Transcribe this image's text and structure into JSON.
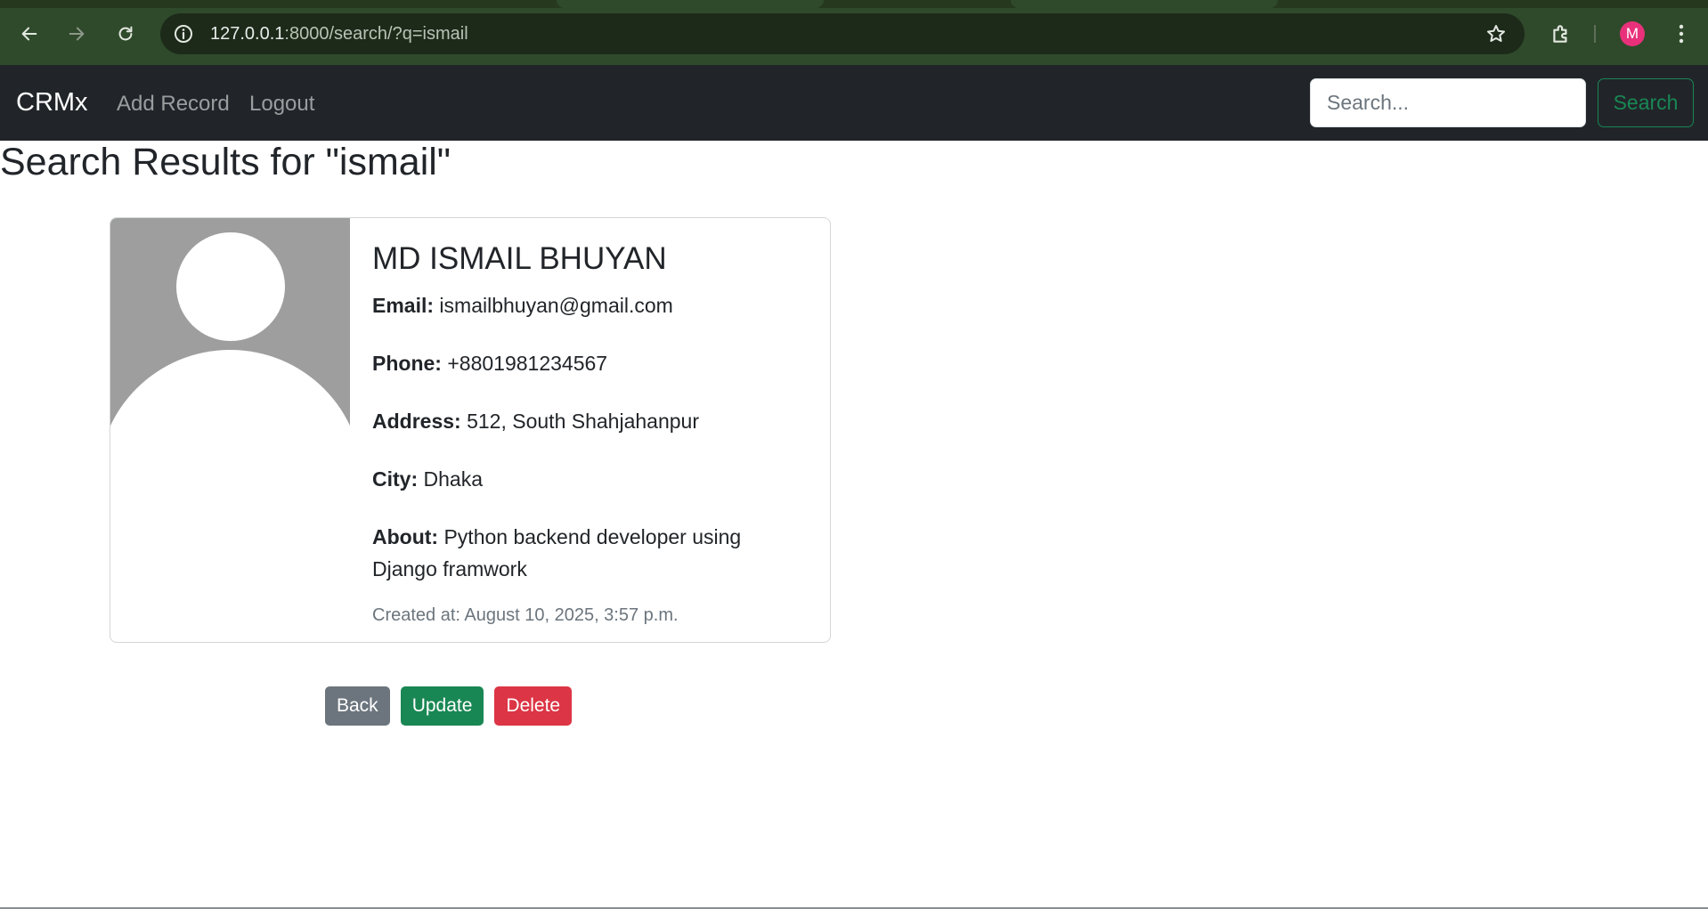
{
  "browser": {
    "url_host": "127.0.0.1",
    "url_rest": ":8000/search/?q=ismail",
    "profile_initial": "M",
    "colors": {
      "frame": "#2f4a2b",
      "omnibox": "#1d2a1a",
      "avatar": "#e8317a"
    },
    "icons": [
      "back-arrow-icon",
      "forward-arrow-icon",
      "reload-icon",
      "site-info-icon",
      "bookmark-star-icon",
      "extensions-puzzle-icon",
      "kebab-menu-icon"
    ]
  },
  "navbar": {
    "brand": "CRMx",
    "links": [
      "Add Record",
      "Logout"
    ],
    "search_placeholder": "Search...",
    "search_button": "Search"
  },
  "page": {
    "title": "Search Results for \"ismail\""
  },
  "record": {
    "name": "MD ISMAIL BHUYAN",
    "email_label": "Email:",
    "email": "ismailbhuyan@gmail.com",
    "phone_label": "Phone:",
    "phone": "+8801981234567",
    "address_label": "Address:",
    "address": "512, South Shahjahanpur",
    "city_label": "City:",
    "city": "Dhaka",
    "about_label": "About:",
    "about": "Python backend developer using Django framwork",
    "created": "Created at: August 10, 2025, 3:57 p.m."
  },
  "actions": {
    "back": "Back",
    "update": "Update",
    "delete": "Delete"
  },
  "colors": {
    "navbar_bg": "#212529",
    "success": "#198754",
    "danger": "#dc3545",
    "secondary": "#6c757d"
  }
}
